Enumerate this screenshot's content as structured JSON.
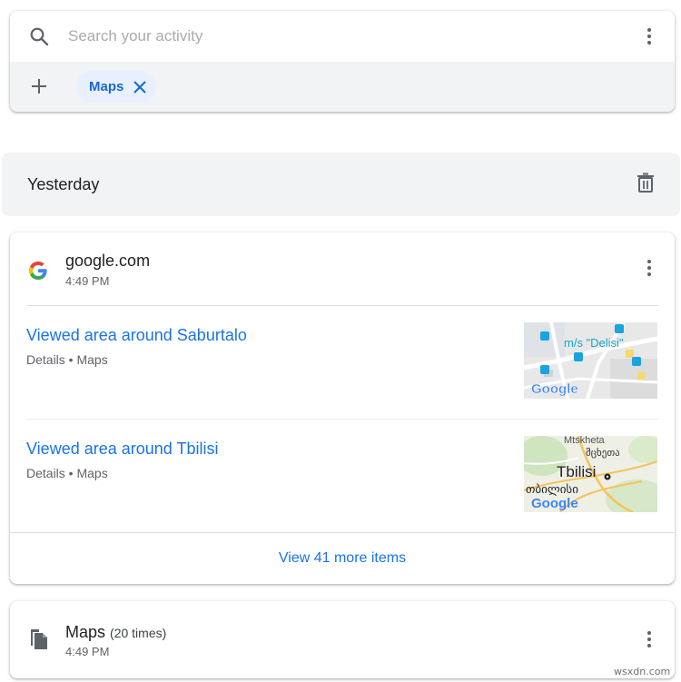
{
  "search": {
    "placeholder": "Search your activity",
    "icon": "search-icon",
    "more_icon": "more-vert-icon"
  },
  "filters": {
    "add_icon": "plus-icon",
    "chips": [
      {
        "label": "Maps",
        "remove_icon": "close-icon"
      }
    ]
  },
  "day_group": {
    "title": "Yesterday",
    "delete_icon": "trash-icon"
  },
  "activity": {
    "site": "google.com",
    "time": "4:49 PM",
    "items": [
      {
        "title": "Viewed area around Saburtalo",
        "meta": "Details • Maps",
        "thumbnail": {
          "label": "m/s \"Delisi\"",
          "logo": "Google"
        }
      },
      {
        "title": "Viewed area around Tbilisi",
        "meta": "Details • Maps",
        "thumbnail": {
          "label_top": "Mtskheta",
          "label_geo_top": "მცხეთა",
          "label_city": "Tbilisi",
          "label_geo_city": "თბილისი",
          "logo": "Google"
        }
      }
    ],
    "view_more": "View 41 more items"
  },
  "bundle": {
    "title": "Maps",
    "count": "(20 times)",
    "time": "4:49 PM"
  },
  "watermark": "wsxdn.com",
  "colors": {
    "link": "#1a73e8",
    "chip_bg": "#e8f0fe",
    "chip_text": "#1967d2",
    "header_bg": "#f1f3f4",
    "secondary_text": "#5f6368"
  }
}
